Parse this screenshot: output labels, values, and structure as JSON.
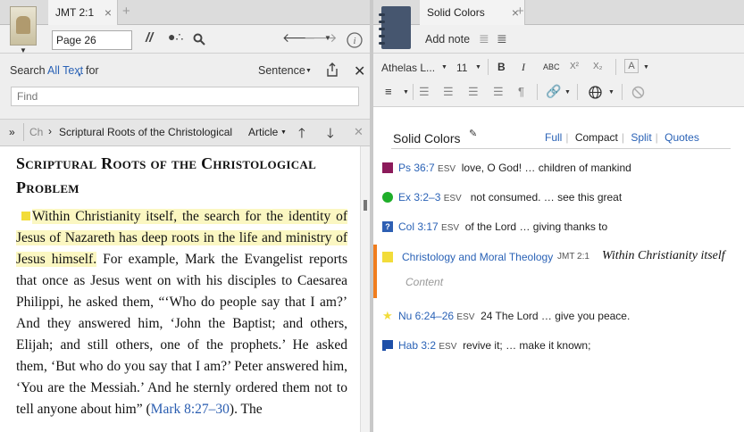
{
  "left_panel": {
    "tab_title": "JMT 2:1",
    "page_input": "Page 26",
    "search": {
      "label": "Search",
      "scope": "All Text",
      "for_label": "for",
      "mode": "Sentence",
      "placeholder": "Find"
    },
    "nav": {
      "chapter_short": "Ch",
      "breadcrumb": "Scriptural Roots of the Christological",
      "type": "Article"
    },
    "reader": {
      "heading": "Scriptural Roots of the Christological Problem",
      "highlighted": "Within Christianity itself, the search for the identity of Jesus of Nazareth has deep roots in the life and ministry of Jesus himself.",
      "body": " For example, Mark the Evangelist reports that once as Jesus went on with his disciples to Caesarea Philippi, he asked them, “‘Who do people say that I am?’ And they answered him, ‘John the Baptist; and others, Elijah; and still others, one of the prophets.’ He asked them, ‘But who do you say that I am?’ Peter answered him, ‘You are the Messiah.’ And he sternly ordered them not to tell anyone about him” (",
      "xref": "Mark 8:27–30",
      "tail": "). The"
    }
  },
  "right_panel": {
    "tab_title": "Solid Colors",
    "add_note": "Add note",
    "font_name": "Athelas L...",
    "font_size": "11",
    "notes_title": "Solid Colors",
    "modes": [
      "Full",
      "Compact",
      "Split",
      "Quotes"
    ],
    "active_mode": "Compact",
    "notes": [
      {
        "swatch": "purple-square",
        "color": "#8b1a5a",
        "ref": "Ps 36:7",
        "version": "ESV",
        "text": "love, O God! … children of mankind"
      },
      {
        "swatch": "green-dot",
        "color": "#1fae2a",
        "ref": "Ex 3:2–3",
        "version": "ESV",
        "text": "not consumed. … see this great"
      },
      {
        "swatch": "question-square",
        "color": "#2e5fb3",
        "ref": "Col 3:17",
        "version": "ESV",
        "text": "of the Lord … giving thanks to"
      },
      {
        "swatch": "yellow-note",
        "color": "#f2dc3a",
        "ref": "Christology and Moral Theology",
        "version": "JMT 2:1",
        "text": "Within Christianity itself",
        "content_placeholder": "Content"
      },
      {
        "swatch": "yellow-star",
        "color": "#f2dc3a",
        "ref": "Nu 6:24–26",
        "version": "ESV",
        "text": "24  The Lord … give you peace."
      },
      {
        "swatch": "blue-flag",
        "color": "#1d4fa8",
        "ref": "Hab 3:2",
        "version": "ESV",
        "text": "revive it;  … make it known;"
      }
    ]
  },
  "colors": {
    "accent_orange": "#f07d1e",
    "highlight_yellow": "#fbf7c2",
    "link_blue": "#2a62b6"
  }
}
